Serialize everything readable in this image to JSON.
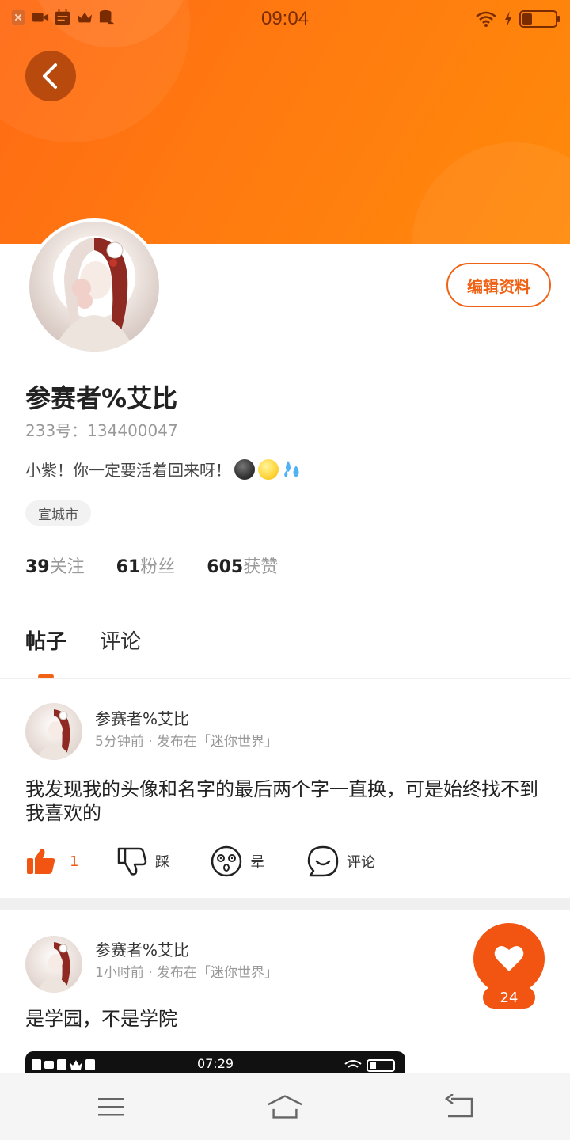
{
  "status_bar": {
    "time": "09:04",
    "left_icons": [
      "notification-x-icon",
      "video-icon",
      "calendar-icon",
      "crown-icon",
      "database-icon"
    ],
    "right_icons": [
      "wifi-icon",
      "charging-icon",
      "battery-icon"
    ]
  },
  "header": {
    "back_icon": "chevron-left-icon",
    "banner_color": "#ff7a10"
  },
  "profile": {
    "name": "参赛者%艾比",
    "id_text": "233号：134400047",
    "bio": "小紫！你一定要活着回来呀！",
    "bio_emojis": [
      "dark-face-emoji",
      "smile-emoji",
      "sweat-drops-emoji"
    ],
    "location": "宣城市",
    "edit_label": "编辑资料",
    "stats": [
      {
        "value": "39",
        "label": "关注"
      },
      {
        "value": "61",
        "label": "粉丝"
      },
      {
        "value": "605",
        "label": "获赞"
      }
    ]
  },
  "tabs": [
    {
      "label": "帖子",
      "active": true
    },
    {
      "label": "评论",
      "active": false
    }
  ],
  "posts": [
    {
      "author": "参赛者%艾比",
      "time": "5分钟前",
      "published_in": "发布在「迷你世界」",
      "text": "我发现我的头像和名字的最后两个字一直换，可是始终找不到我喜欢的",
      "actions": {
        "like_count": "1",
        "dislike_label": "踩",
        "dizzy_label": "晕",
        "comment_label": "评论"
      }
    },
    {
      "author": "参赛者%艾比",
      "time": "1小时前",
      "published_in": "发布在「迷你世界」",
      "text": "是学园，不是学院",
      "image_time": "07:29"
    }
  ],
  "fab": {
    "icon": "heart-icon",
    "count": "24"
  },
  "nav": {
    "icons": [
      "menu-icon",
      "home-icon",
      "return-icon"
    ]
  },
  "colors": {
    "accent": "#f06316",
    "fab": "#f25511"
  }
}
